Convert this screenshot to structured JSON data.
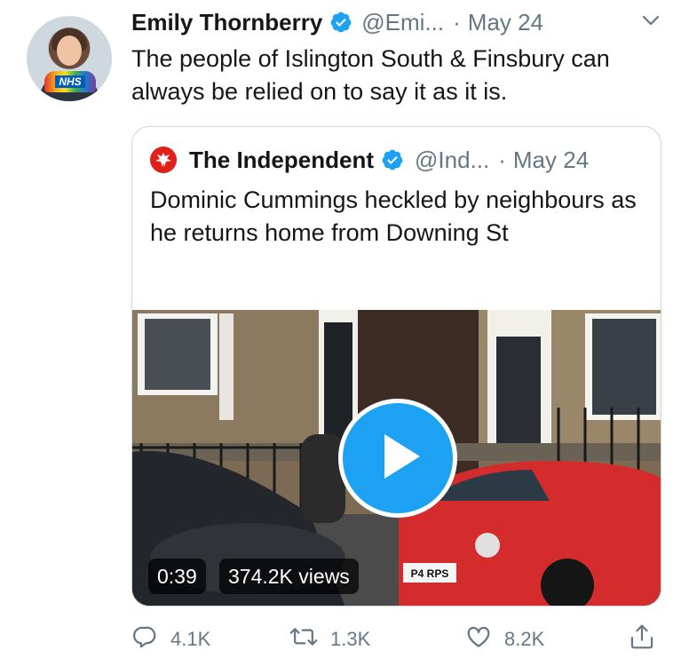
{
  "author": {
    "name": "Emily Thornberry",
    "handle": "@Emi...",
    "separator": "·",
    "date": "May 24",
    "badge_text": "NHS"
  },
  "tweet": {
    "text": "The people of Islington South & Finsbury can always be relied on to say it as it is."
  },
  "quoted": {
    "name": "The Independent",
    "handle": "@Ind...",
    "separator": "·",
    "date": "May 24",
    "text": "Dominic Cummings heckled by neighbours as he returns home from Downing St",
    "media": {
      "duration": "0:39",
      "views": "374.2K views",
      "plate": "P4 RPS"
    }
  },
  "actions": {
    "replies": "4.1K",
    "retweets": "1.3K",
    "likes": "8.2K"
  },
  "colors": {
    "verified": "#1da1f2",
    "muted": "#657786",
    "border": "#ccd6dd",
    "play": "#1da1f2",
    "independent_red": "#e0211b"
  },
  "icons": [
    "verified-badge-icon",
    "chevron-down-icon",
    "independent-eagle-icon",
    "play-icon",
    "reply-icon",
    "retweet-icon",
    "like-icon",
    "share-icon"
  ]
}
